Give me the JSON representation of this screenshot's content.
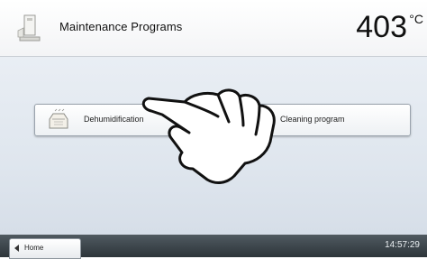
{
  "header": {
    "title": "Maintenance Programs",
    "temperature": "403",
    "temperature_unit": "°C",
    "icon": "maintenance-icon"
  },
  "main": {
    "buttons": [
      {
        "label": "Dehumidification",
        "icon": "dehumidification-icon"
      },
      {
        "label": "Cleaning program",
        "icon": "cleaning-icon"
      }
    ]
  },
  "footer": {
    "home_label": "Home",
    "clock": "14:57:29"
  },
  "overlay": {
    "icon": "pointing-hand-icon"
  },
  "colors": {
    "background": "#dfe6ee",
    "footer": "#353d42",
    "button_border": "#9aa3ad"
  }
}
